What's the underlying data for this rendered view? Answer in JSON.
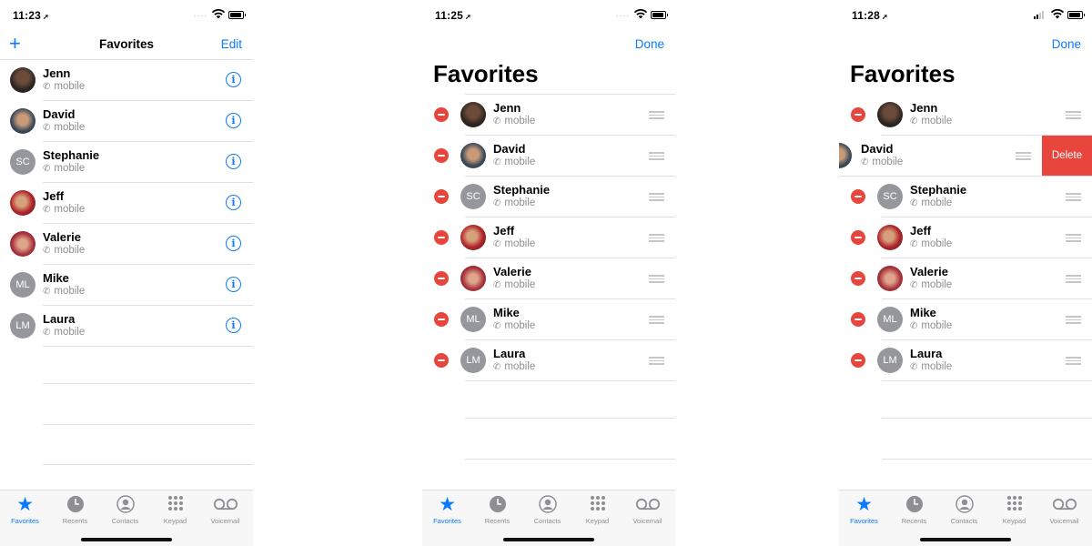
{
  "phones": [
    {
      "time": "11:23",
      "nav": {
        "left": "+",
        "title": "Favorites",
        "right": "Edit"
      },
      "contacts": [
        {
          "name": "Jenn",
          "label": "mobile",
          "initials": ""
        },
        {
          "name": "David",
          "label": "mobile",
          "initials": ""
        },
        {
          "name": "Stephanie",
          "label": "mobile",
          "initials": "SC"
        },
        {
          "name": "Jeff",
          "label": "mobile",
          "initials": ""
        },
        {
          "name": "Valerie",
          "label": "mobile",
          "initials": ""
        },
        {
          "name": "Mike",
          "label": "mobile",
          "initials": "ML"
        },
        {
          "name": "Laura",
          "label": "mobile",
          "initials": "LM"
        }
      ]
    },
    {
      "time": "11:25",
      "nav": {
        "right": "Done"
      },
      "big_title": "Favorites",
      "contacts": [
        {
          "name": "Jenn",
          "label": "mobile",
          "initials": ""
        },
        {
          "name": "David",
          "label": "mobile",
          "initials": ""
        },
        {
          "name": "Stephanie",
          "label": "mobile",
          "initials": "SC"
        },
        {
          "name": "Jeff",
          "label": "mobile",
          "initials": ""
        },
        {
          "name": "Valerie",
          "label": "mobile",
          "initials": ""
        },
        {
          "name": "Mike",
          "label": "mobile",
          "initials": "ML"
        },
        {
          "name": "Laura",
          "label": "mobile",
          "initials": "LM"
        }
      ]
    },
    {
      "time": "11:28",
      "nav": {
        "right": "Done"
      },
      "big_title": "Favorites",
      "delete_label": "Delete",
      "contacts": [
        {
          "name": "Jenn",
          "label": "mobile",
          "initials": ""
        },
        {
          "name": "David",
          "label": "mobile",
          "initials": ""
        },
        {
          "name": "Stephanie",
          "label": "mobile",
          "initials": "SC"
        },
        {
          "name": "Jeff",
          "label": "mobile",
          "initials": ""
        },
        {
          "name": "Valerie",
          "label": "mobile",
          "initials": ""
        },
        {
          "name": "Mike",
          "label": "mobile",
          "initials": "ML"
        },
        {
          "name": "Laura",
          "label": "mobile",
          "initials": "LM"
        }
      ]
    }
  ],
  "tabbar": [
    {
      "label": "Favorites",
      "icon": "star-icon",
      "active": true
    },
    {
      "label": "Recents",
      "icon": "clock-icon",
      "active": false
    },
    {
      "label": "Contacts",
      "icon": "person-circle-icon",
      "active": false
    },
    {
      "label": "Keypad",
      "icon": "keypad-icon",
      "active": false
    },
    {
      "label": "Voicemail",
      "icon": "voicemail-icon",
      "active": false
    }
  ],
  "colors": {
    "accent": "#0a7aff",
    "destructive": "#e8453c",
    "avatar_grey": "#95979d"
  }
}
